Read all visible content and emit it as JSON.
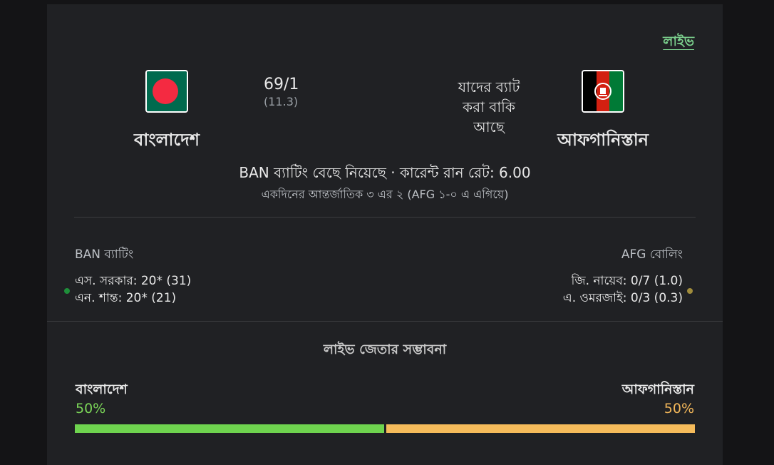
{
  "live_label": "লাইভ",
  "teams": {
    "home": {
      "name": "বাংলাদেশ",
      "flag": "bangladesh-flag-icon",
      "score": "69/1",
      "overs": "(11.3)"
    },
    "away": {
      "name": "আফগানিস্তান",
      "flag": "afghanistan-flag-icon",
      "status": "যাদের ব্যাট করা বাকি আছে"
    }
  },
  "status": {
    "main": "BAN ব্যাটিং বেছে নিয়েছে · কারেন্ট রান রেট: 6.00",
    "sub": "একদিনের আন্তর্জাতিক ৩ এর ২ (AFG ১-০ এ এগিয়ে)"
  },
  "batting": {
    "heading": "BAN ব্যাটিং",
    "players": [
      "এস. সরকার: 20* (31)",
      "এন. শান্ত: 20* (21)"
    ]
  },
  "bowling": {
    "heading": "AFG বোলিং",
    "players": [
      "জি. নায়েব: 0/7 (1.0)",
      "এ. ওমরজাই: 0/3 (0.3)"
    ]
  },
  "win_probability": {
    "title": "লাইভ জেতার সম্ভাবনা",
    "home_name": "বাংলাদেশ",
    "away_name": "আফগানিস্তান",
    "home_pct": "50%",
    "away_pct": "50%",
    "home_fraction": 0.5,
    "away_fraction": 0.5
  },
  "colors": {
    "live": "#7bd08d",
    "home_bar": "#6fd44f",
    "away_bar": "#f5bb5b",
    "flag_bd_green": "#006a4e",
    "flag_bd_red": "#f42a41"
  }
}
